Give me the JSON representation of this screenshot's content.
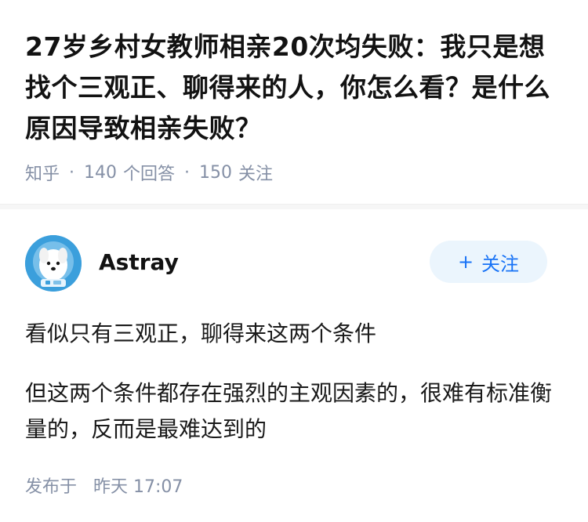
{
  "question": {
    "title": "27岁乡村女教师相亲20次均失败：我只是想找个三观正、聊得来的人，你怎么看？是什么原因导致相亲失败？",
    "source": "知乎",
    "answer_count": "140",
    "answer_label": "个回答",
    "follow_count": "150",
    "follow_label": "关注"
  },
  "answer": {
    "author": "Astray",
    "follow_button": {
      "icon": "+",
      "label": "关注"
    },
    "paragraphs": [
      "看似只有三观正，聊得来这两个条件",
      "但这两个条件都存在强烈的主观因素的，很难有标准衡量的，反而是最难达到的"
    ],
    "published_label": "发布于",
    "published_time": "昨天 17:07"
  },
  "colors": {
    "meta_gray": "#8590a6",
    "accent_blue": "#1772f6",
    "follow_bg": "#ebf5fd",
    "avatar_bg": "#3b9fdc"
  }
}
